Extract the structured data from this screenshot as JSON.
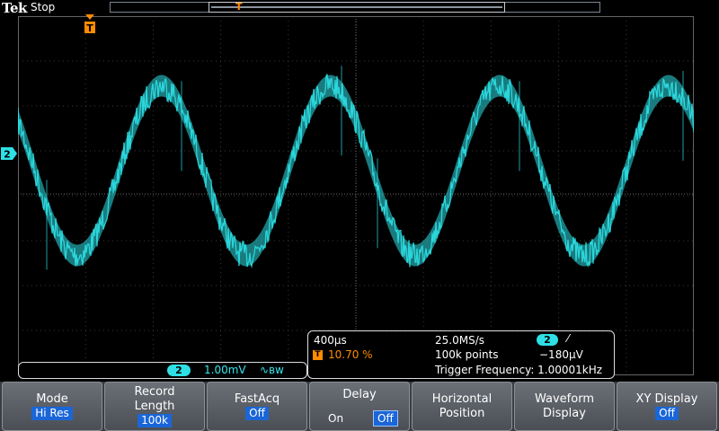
{
  "header": {
    "brand": "Tek",
    "run_state": "Stop"
  },
  "channel": {
    "number": "2",
    "scale": "1.00mV",
    "bandwidth_symbol": "∿ʙᴡ",
    "color": "#2ee0e6"
  },
  "horizontal": {
    "timebase": "400µs",
    "trigger_position": "10.70 %",
    "sample_rate": "25.0MS/s",
    "record_points": "100k points"
  },
  "trigger": {
    "source": "2",
    "slope_symbol": "⁄",
    "level": "−180µV",
    "frequency": "Trigger Frequency: 1.00001kHz",
    "marker": "T",
    "color": "#ff8c00"
  },
  "waveform": {
    "periods_on_screen": 4.0,
    "amplitude_divisions": 2.1,
    "trace_color": "#2ee0e6"
  },
  "menu": {
    "mode": {
      "label": "Mode",
      "value": "Hi Res"
    },
    "record_length": {
      "label": "Record Length",
      "value": "100k"
    },
    "fastacq": {
      "label": "FastAcq",
      "value": "Off"
    },
    "delay": {
      "label": "Delay",
      "on": "On",
      "off": "Off"
    },
    "horizontal_position": {
      "label": "Horizontal Position"
    },
    "waveform_display": {
      "label": "Waveform Display"
    },
    "xy_display": {
      "label": "XY Display",
      "value": "Off"
    }
  }
}
